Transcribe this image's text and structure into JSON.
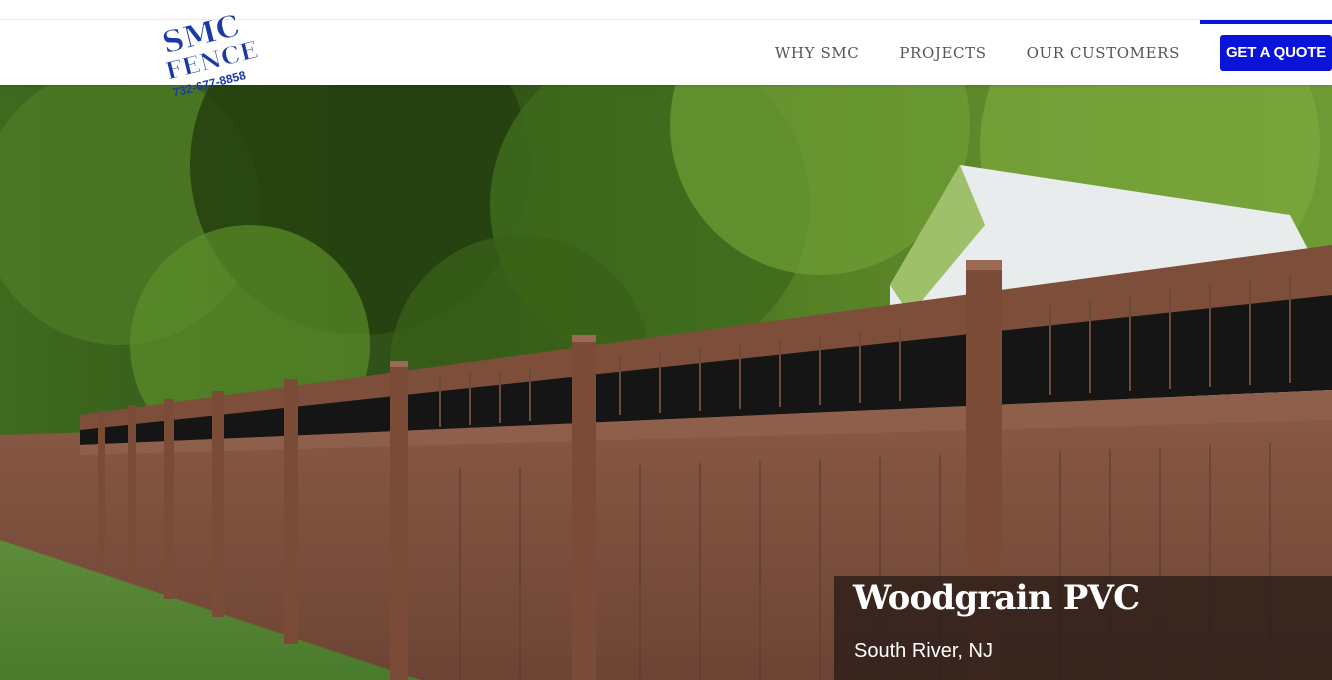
{
  "brand": {
    "logo_line1": "SMC",
    "logo_line2": "FENCE",
    "logo_phone": "732-677-8858",
    "color_primary": "#0a14d8",
    "logo_color": "#1b3aa6"
  },
  "nav": {
    "items": [
      {
        "label": "WHY SMC"
      },
      {
        "label": "PROJECTS"
      },
      {
        "label": "OUR CUSTOMERS"
      }
    ],
    "cta_label": "GET A QUOTE"
  },
  "hero": {
    "image_subject": "woodgrain-pvc-fence-photo",
    "caption_title": "Woodgrain PVC",
    "caption_location": "South River, NJ"
  }
}
